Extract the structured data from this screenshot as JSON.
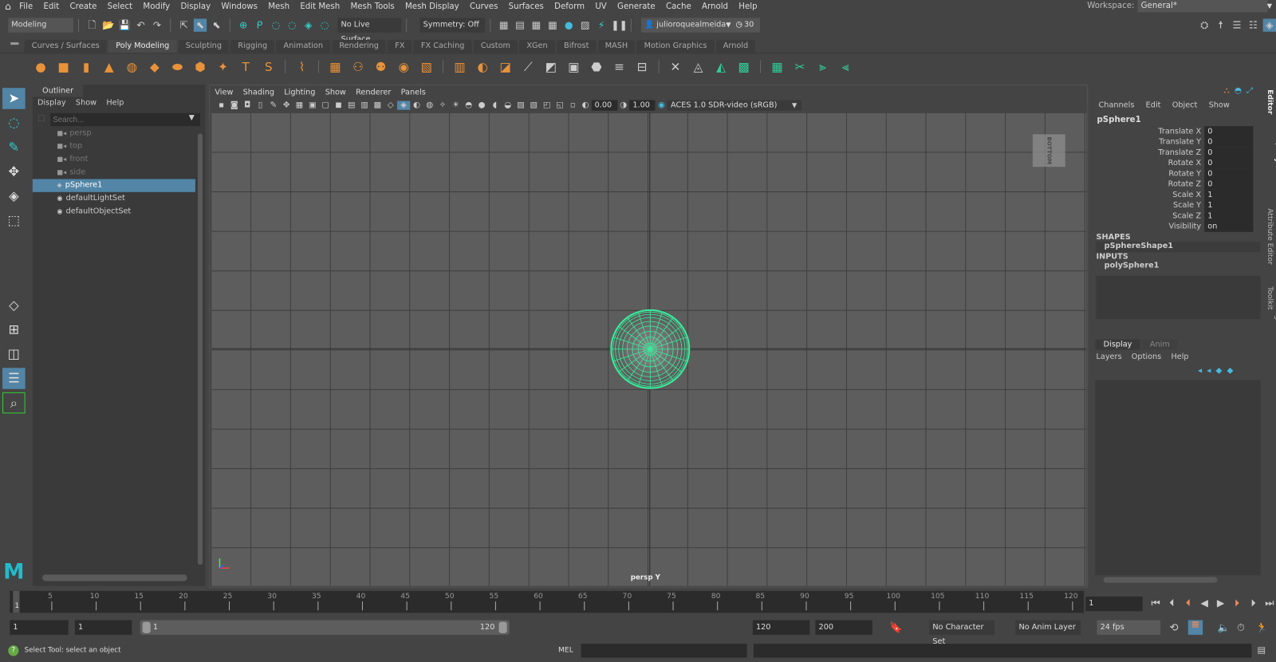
{
  "menu": [
    "File",
    "Edit",
    "Create",
    "Select",
    "Modify",
    "Display",
    "Windows",
    "Mesh",
    "Edit Mesh",
    "Mesh Tools",
    "Mesh Display",
    "Curves",
    "Surfaces",
    "Deform",
    "UV",
    "Generate",
    "Cache",
    "Arnold",
    "Help"
  ],
  "workspace": {
    "label": "Workspace:",
    "value": "General*"
  },
  "status": {
    "mode": "Modeling",
    "live_surface": "No Live Surface",
    "symmetry": "Symmetry: Off",
    "user": "julioroquealmeida",
    "credits": "30"
  },
  "shelf_tabs": [
    "Curves / Surfaces",
    "Poly Modeling",
    "Sculpting",
    "Rigging",
    "Animation",
    "Rendering",
    "FX",
    "FX Caching",
    "Custom",
    "XGen",
    "Bifrost",
    "MASH",
    "Motion Graphics",
    "Arnold"
  ],
  "active_shelf": "Poly Modeling",
  "shelf_icons": [
    "sphere",
    "cube",
    "cylinder",
    "cone",
    "torus",
    "plane",
    "disc",
    "platonic",
    "super-shape",
    "type",
    "svg",
    "sweep",
    "mirror",
    "combine",
    "separate",
    "smooth",
    "extract",
    "bridge",
    "boolean",
    "append",
    "multicut",
    "bevel",
    "extrude",
    "bridge-edge",
    "insert-loop",
    "offset-loop",
    "target-weld",
    "fill-hole",
    "triangulate",
    "quadrangulate",
    "uv-editor",
    "cut-uvs",
    "unfold",
    "layout"
  ],
  "outliner": {
    "title": "Outliner",
    "menu": [
      "Display",
      "Show",
      "Help"
    ],
    "search_placeholder": "Search...",
    "items": [
      {
        "label": "persp",
        "type": "camera",
        "dim": true
      },
      {
        "label": "top",
        "type": "camera",
        "dim": true
      },
      {
        "label": "front",
        "type": "camera",
        "dim": true
      },
      {
        "label": "side",
        "type": "camera",
        "dim": true
      },
      {
        "label": "pSphere1",
        "type": "mesh",
        "selected": true
      },
      {
        "label": "defaultLightSet",
        "type": "set"
      },
      {
        "label": "defaultObjectSet",
        "type": "set"
      }
    ]
  },
  "viewport": {
    "menu": [
      "View",
      "Shading",
      "Lighting",
      "Show",
      "Renderer",
      "Panels"
    ],
    "exposure": "0.00",
    "gamma": "1.00",
    "color_space": "ACES 1.0 SDR-video (sRGB)",
    "camera_label": "persp Y",
    "viewcube": "BOTTOM"
  },
  "channel_box": {
    "menu": [
      "Channels",
      "Edit",
      "Object",
      "Show"
    ],
    "object": "pSphere1",
    "attrs": [
      {
        "label": "Translate X",
        "value": "0"
      },
      {
        "label": "Translate Y",
        "value": "0"
      },
      {
        "label": "Translate Z",
        "value": "0"
      },
      {
        "label": "Rotate X",
        "value": "0"
      },
      {
        "label": "Rotate Y",
        "value": "0"
      },
      {
        "label": "Rotate Z",
        "value": "0"
      },
      {
        "label": "Scale X",
        "value": "1"
      },
      {
        "label": "Scale Y",
        "value": "1"
      },
      {
        "label": "Scale Z",
        "value": "1"
      },
      {
        "label": "Visibility",
        "value": "on"
      }
    ],
    "shapes_label": "SHAPES",
    "shape": "pSphereShape1",
    "inputs_label": "INPUTS",
    "input": "polySphere1"
  },
  "layer_editor": {
    "tabs": [
      "Display",
      "Anim"
    ],
    "menu": [
      "Layers",
      "Options",
      "Help"
    ]
  },
  "side_tabs": [
    "Channel Box / Layer Editor",
    "Attribute Editor",
    "Modeling Toolkit"
  ],
  "timeline": {
    "start": 1,
    "end": 120,
    "current": "1",
    "labels": [
      5,
      10,
      15,
      20,
      25,
      30,
      35,
      40,
      45,
      50,
      55,
      60,
      65,
      70,
      75,
      80,
      85,
      90,
      95,
      100,
      105,
      110,
      115,
      120
    ]
  },
  "range": {
    "start": "1",
    "anim_start": "1",
    "slider_start": "1",
    "slider_end": "120",
    "end": "120",
    "anim_end": "200",
    "character_set": "No Character Set",
    "anim_layer": "No Anim Layer",
    "fps": "24 fps"
  },
  "command": {
    "help": "Select Tool: select an object",
    "lang": "MEL"
  },
  "colors": {
    "accent": "#5285a6",
    "wire": "#3bea9a",
    "bg": "#444444",
    "viewport": "#5d5d5d"
  }
}
